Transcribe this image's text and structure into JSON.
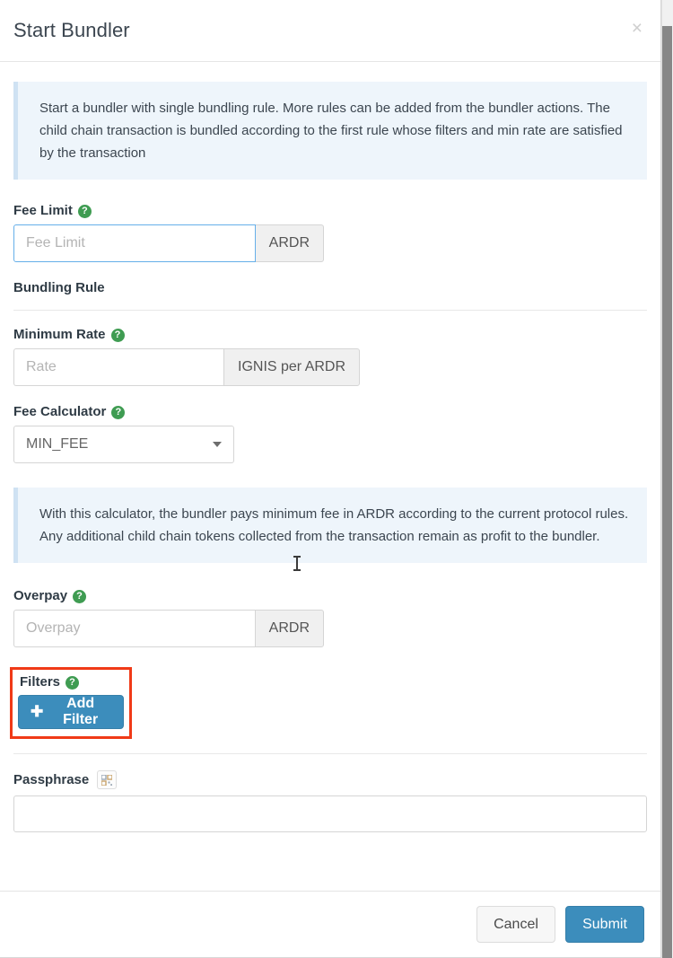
{
  "modal": {
    "title": "Start Bundler",
    "close_label": "×"
  },
  "info_alerts": {
    "intro": "Start a bundler with single bundling rule. More rules can be added from the bundler actions. The child chain transaction is bundled according to the first rule whose filters and min rate are satisfied by the transaction",
    "calculator": "With this calculator, the bundler pays minimum fee in ARDR according to the current protocol rules. Any additional child chain tokens collected from the transaction remain as profit to the bundler."
  },
  "form": {
    "fee_limit": {
      "label": "Fee Limit",
      "placeholder": "Fee Limit",
      "value": "",
      "addon": "ARDR",
      "help": "?"
    },
    "bundling_rule": {
      "label": "Bundling Rule"
    },
    "minimum_rate": {
      "label": "Minimum Rate",
      "placeholder": "Rate",
      "value": "",
      "addon": "IGNIS per ARDR",
      "help": "?"
    },
    "fee_calculator": {
      "label": "Fee Calculator",
      "selected": "MIN_FEE",
      "options": [
        "MIN_FEE"
      ],
      "help": "?"
    },
    "overpay": {
      "label": "Overpay",
      "placeholder": "Overpay",
      "value": "",
      "addon": "ARDR",
      "help": "?"
    },
    "filters": {
      "label": "Filters",
      "help": "?",
      "add_button": "Add Filter",
      "add_icon": "plus-icon",
      "highlight_color": "#f03a17"
    },
    "passphrase": {
      "label": "Passphrase",
      "value": "",
      "placeholder": "",
      "qr_icon": "qr-code-icon"
    }
  },
  "footer": {
    "cancel_label": "Cancel",
    "submit_label": "Submit"
  },
  "theme": {
    "primary": "#3c8dbc",
    "help_green": "#3f9c52",
    "info_bg": "#eef5fb",
    "info_border": "#cfe2f3"
  }
}
